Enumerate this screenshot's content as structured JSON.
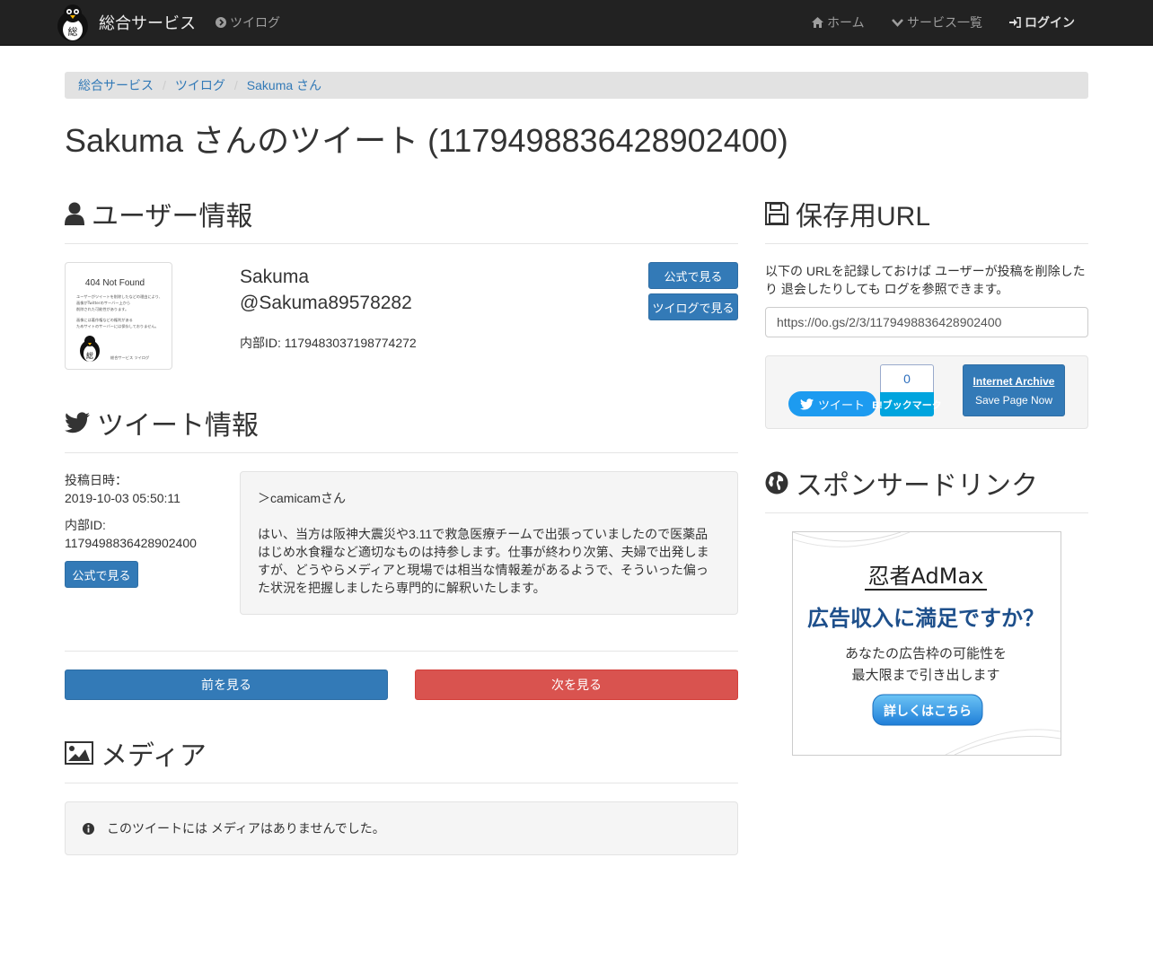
{
  "navbar": {
    "brand": "総合サービス",
    "twilog_link": "ツイログ",
    "home": "ホーム",
    "services": "サービス一覧",
    "login": "ログイン"
  },
  "breadcrumb": [
    "総合サービス",
    "ツイログ",
    "Sakuma さん"
  ],
  "page_title": "Sakuma さんのツイート (1179498836428902400)",
  "user_section": {
    "heading": "ユーザー情報",
    "avatar_text": "404 Not Found",
    "avatar_small_lines": [
      "ユーザーがツイートを削除したなどの理由により、",
      "画像がTwitterのサーバー上から",
      "削除された可能性があります。",
      "画像には著作権などの権利がある",
      "ためサイトのサーバーには保存しておりません。"
    ],
    "avatar_footer": "総合サービス ツイログ",
    "name": "Sakuma",
    "handle": "@Sakuma89578282",
    "internal_id": "内部ID: 1179483037198774272",
    "btn_official": "公式で見る",
    "btn_twilog": "ツイログで見る"
  },
  "tweet_section": {
    "heading": "ツイート情報",
    "posted_label": "投稿日時：",
    "posted_value": "2019-10-03 05:50:11",
    "internal_label": "内部ID:",
    "internal_value": "1179498836428902400",
    "btn_official": "公式で見る",
    "text_line1": "＞camicamさん",
    "text_body": "はい、当方は阪神大震災や3.11で救急医療チームで出張っていましたので医薬品はじめ水食糧など適切なものは持参します。仕事が終わり次第、夫婦で出発しますが、どうやらメディアと現場では相当な情報差があるようで、そういった偏った状況を把握しましたら専門的に解釈いたします。"
  },
  "pager": {
    "prev": "前を見る",
    "next": "次を見る"
  },
  "media_section": {
    "heading": "メディア",
    "empty_message": "このツイートには メディアはありませんでした。"
  },
  "save_section": {
    "heading": "保存用URL",
    "description": "以下の URLを記録しておけば ユーザーが投稿を削除したり 退会したりしても ログを参照できます。",
    "url": "https://0o.gs/2/3/1179498836428902400",
    "tweet_button": "ツイート",
    "hatena_count": "0",
    "hatena_button": "B!ブックマーク",
    "ia_title": "Internet Archive",
    "ia_sub": "Save Page Now"
  },
  "sponsor_section": {
    "heading": "スポンサードリンク",
    "ad_logo": "忍者AdMax",
    "ad_headline": "広告収入に満足ですか？",
    "ad_line1": "あなたの広告枠の可能性を",
    "ad_line2": "最大限まで引き出します",
    "ad_button": "詳しくはこちら"
  },
  "colors": {
    "primary": "#337ab7",
    "danger": "#d9534f",
    "navbar": "#222222",
    "twitter": "#1d9bf0",
    "hatena": "#00a4de"
  }
}
